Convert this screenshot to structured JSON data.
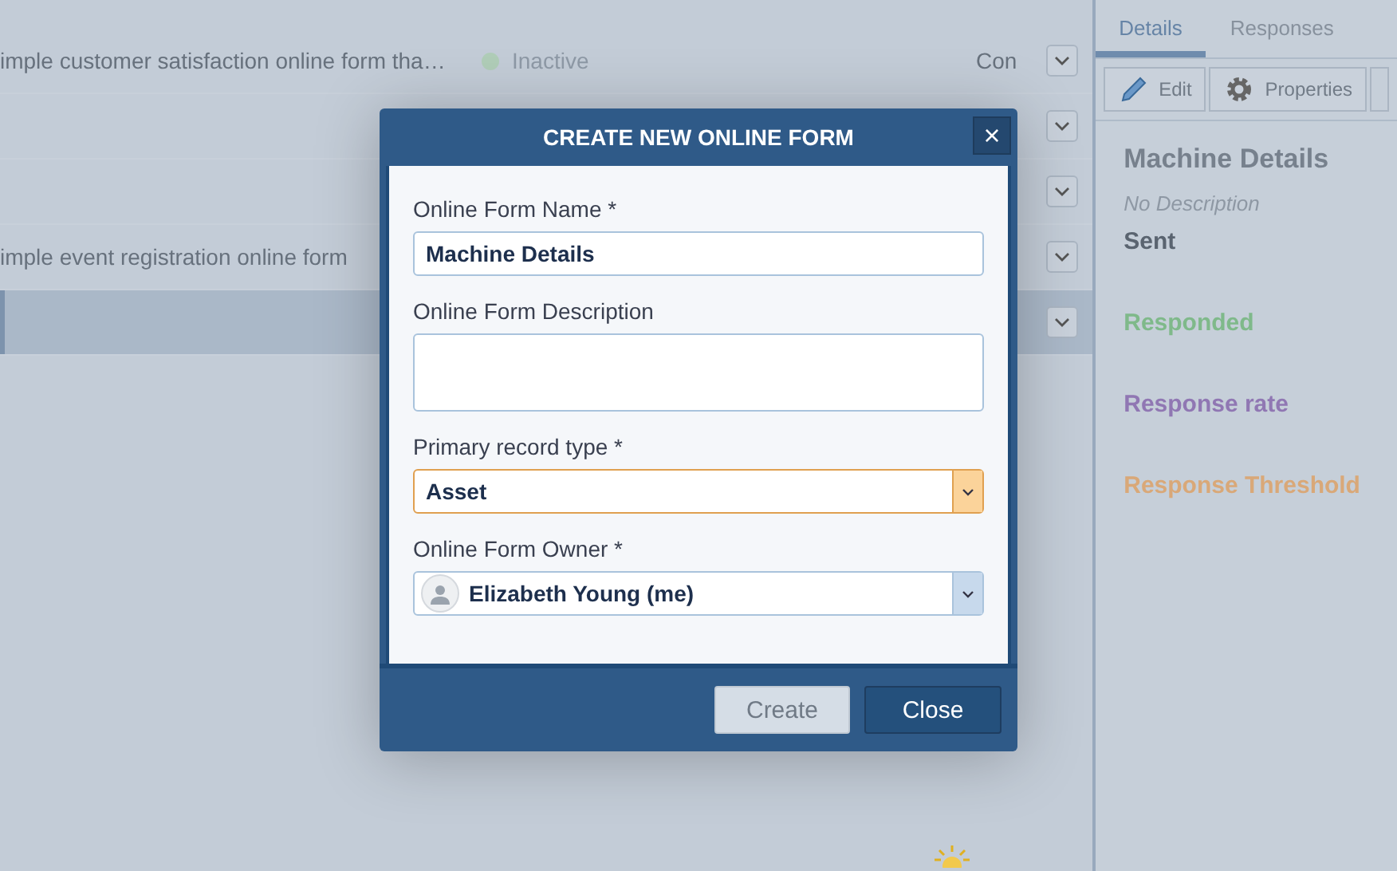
{
  "list_rows": [
    {
      "description": "imple customer satisfaction online form tha…",
      "status": "Inactive",
      "column_3": "Con",
      "selected": false
    },
    {
      "selected": false
    },
    {
      "selected": false
    },
    {
      "description": "imple event registration online form",
      "selected": false
    },
    {
      "selected": true
    }
  ],
  "side_panel": {
    "tabs": [
      {
        "label": "Details",
        "selected": true
      },
      {
        "label": "Responses",
        "selected": false
      }
    ],
    "toolbar": [
      {
        "label": "Edit",
        "kind": "edit"
      },
      {
        "label": "Properties",
        "kind": "properties"
      }
    ],
    "title": "Machine Details",
    "description": "No Description",
    "stats": [
      {
        "label": "Sent",
        "color": "#5a6470"
      },
      {
        "label": "Responded",
        "color": "#7fb98a"
      },
      {
        "label": "Response rate",
        "color": "#9077b3"
      },
      {
        "label": "Response Threshold",
        "color": "#d9a878"
      }
    ]
  },
  "dialog": {
    "title": "CREATE NEW ONLINE FORM",
    "close": "×",
    "fields": [
      {
        "label": "Online Form Name *",
        "kind": "text",
        "value": "Machine Details",
        "focused": false
      },
      {
        "label": "Online Form Description",
        "kind": "textarea",
        "focused": false
      },
      {
        "label": "Primary record type *",
        "kind": "select",
        "value": "Asset",
        "focused": true
      },
      {
        "label": "Online Form Owner *",
        "kind": "owner",
        "value": "Elizabeth Young (me)",
        "focused": false
      }
    ],
    "buttons": [
      {
        "label": "Create",
        "disabled": true
      },
      {
        "label": "Close",
        "disabled": false
      }
    ]
  }
}
